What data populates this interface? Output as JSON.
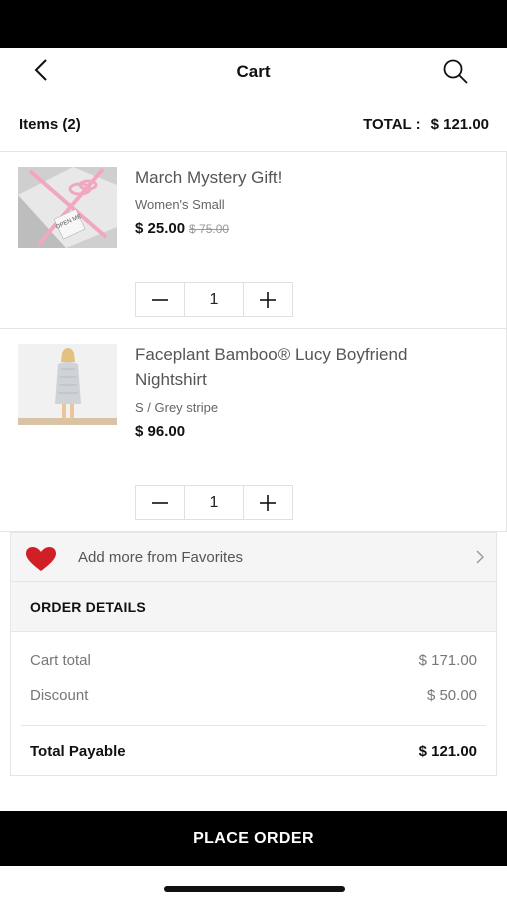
{
  "header": {
    "title": "Cart",
    "back_icon": "chevron-left-icon",
    "search_icon": "search-icon"
  },
  "summary": {
    "items_label": "Items (2)",
    "total_label": "TOTAL :",
    "total_value": "$ 121.00"
  },
  "cart": {
    "items": [
      {
        "name": "March Mystery Gift!",
        "variant": "Women's Small",
        "price": "$ 25.00",
        "old_price": "$ 75.00",
        "quantity": "1",
        "image_text": "OPEN ME"
      },
      {
        "name": "Faceplant Bamboo® Lucy Boyfriend Nightshirt",
        "variant": "S / Grey stripe",
        "price": "$ 96.00",
        "quantity": "1"
      }
    ]
  },
  "favorites": {
    "label": "Add more from Favorites",
    "icon": "heart-icon"
  },
  "order_details": {
    "title": "ORDER DETAILS",
    "cart_total_label": "Cart total",
    "cart_total_value": "$ 171.00",
    "discount_label": "Discount",
    "discount_value": "$ 50.00",
    "payable_label": "Total Payable",
    "payable_value": "$ 121.00"
  },
  "actions": {
    "place_order": "PLACE ORDER"
  },
  "colors": {
    "accent": "#000000",
    "heart": "#d11f26",
    "ribbon": "#f2a7c0"
  }
}
